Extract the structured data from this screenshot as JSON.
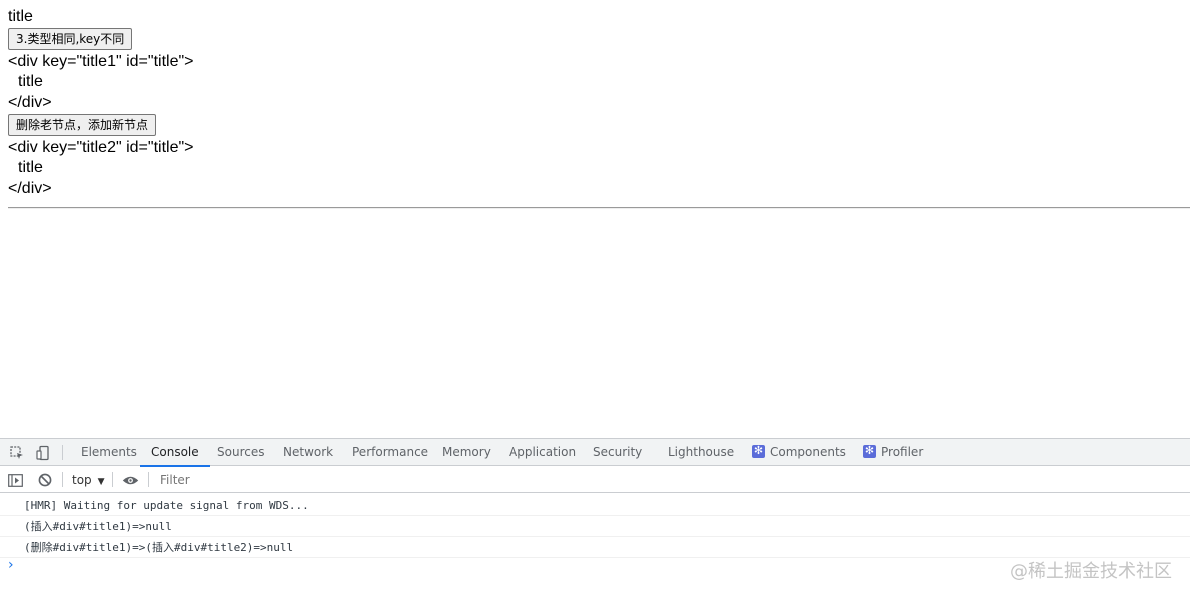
{
  "app": {
    "heading": "title",
    "button1": "3.类型相同,key不同",
    "block1": {
      "open": "<div key=\"title1\" id=\"title\">",
      "content": "title",
      "close": "</div>"
    },
    "button2": "删除老节点，添加新节点",
    "block2": {
      "open": "<div key=\"title2\" id=\"title\">",
      "content": "title",
      "close": "</div>"
    }
  },
  "devtools": {
    "icons": {
      "inspect": "inspect-element-icon",
      "device": "device-toolbar-icon",
      "sidebar": "show-sidebar-icon",
      "clear": "clear-console-icon",
      "eye": "live-expression-eye-icon"
    },
    "tabs": [
      {
        "label": "Elements"
      },
      {
        "label": "Console"
      },
      {
        "label": "Sources"
      },
      {
        "label": "Network"
      },
      {
        "label": "Performance"
      },
      {
        "label": "Memory"
      },
      {
        "label": "Application"
      },
      {
        "label": "Security"
      },
      {
        "label": "Lighthouse"
      },
      {
        "label": "Components"
      },
      {
        "label": "Profiler"
      }
    ],
    "active_tab": "Console",
    "context": "top",
    "filter_placeholder": "Filter",
    "messages": [
      "[HMR] Waiting for update signal from WDS...",
      "(插入#div#title1)=>null",
      "(删除#div#title1)=>(插入#div#title2)=>null"
    ],
    "prompt": "›",
    "accent": "#1a73e8"
  },
  "watermark": "@稀土掘金技术社区"
}
